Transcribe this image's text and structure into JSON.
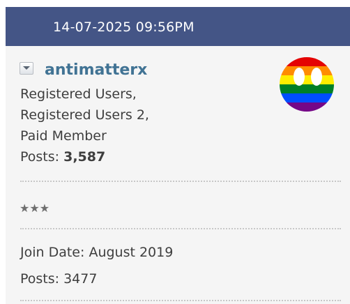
{
  "post": {
    "date": "14-07-2025 09:56PM"
  },
  "user": {
    "username": "antimatterx",
    "groups": [
      "Registered Users,",
      "Registered Users 2,",
      "Paid Member"
    ],
    "posts_label": "Posts: ",
    "posts_count": "3,587",
    "rank": "★★★",
    "join_date": "Join Date: August 2019",
    "posts_line": "Posts: 3477",
    "avatar_icon": "rainbow-face-icon"
  },
  "colors": {
    "header_bg": "#445586",
    "username": "#417394",
    "panel_bg": "#f5f5f5",
    "text": "#3e3e3e"
  }
}
